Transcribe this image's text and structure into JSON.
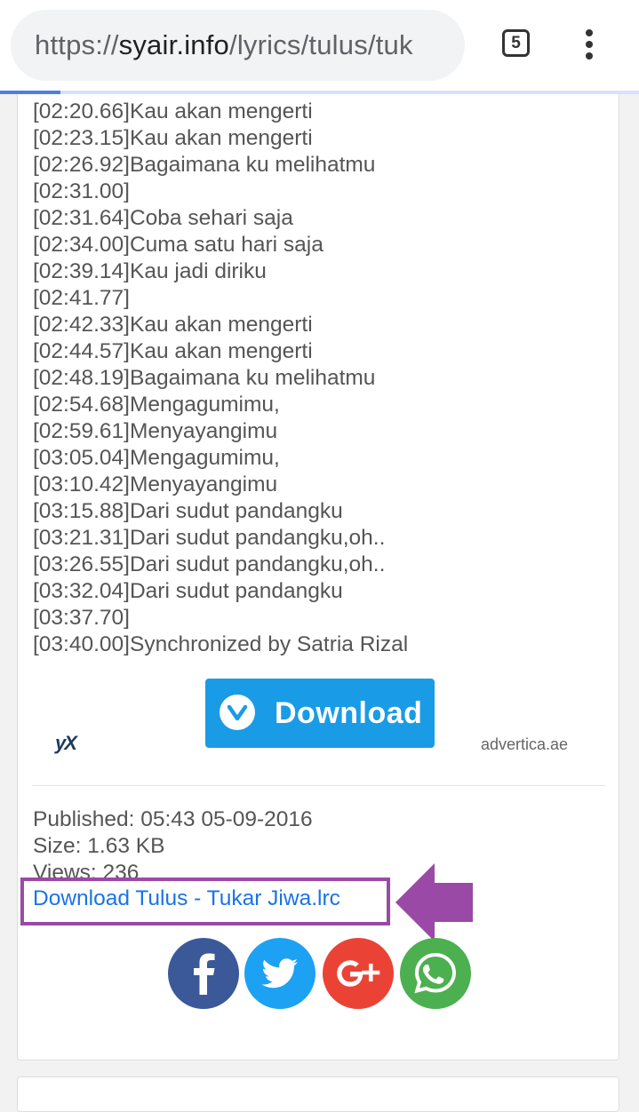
{
  "browser": {
    "url_prefix": "https://",
    "url_domain": "syair.info",
    "url_path": "/lyrics/tulus/tuk",
    "tab_count": "5"
  },
  "lyrics": [
    "[02:20.66]Kau akan mengerti",
    "[02:23.15]Kau akan mengerti",
    "[02:26.92]Bagaimana ku melihatmu",
    "[02:31.00]",
    "[02:31.64]Coba sehari saja",
    "[02:34.00]Cuma satu hari saja",
    "[02:39.14]Kau jadi diriku",
    "[02:41.77]",
    "[02:42.33]Kau akan mengerti",
    "[02:44.57]Kau akan mengerti",
    "[02:48.19]Bagaimana ku melihatmu",
    "[02:54.68]Mengagumimu,",
    "[02:59.61]Menyayangimu",
    "[03:05.04]Mengagumimu,",
    "[03:10.42]Menyayangimu",
    "[03:15.88]Dari sudut pandangku",
    "[03:21.31]Dari sudut pandangku,oh..",
    "[03:26.55]Dari sudut pandangku,oh..",
    "[03:32.04]Dari sudut pandangku",
    "[03:37.70]",
    "[03:40.00]Synchronized by Satria Rizal"
  ],
  "ad": {
    "button_label": "Download",
    "logo": "yX",
    "brand": "advertica.ae",
    "button_color": "#1a9be6"
  },
  "meta": {
    "published": "Published: 05:43 05-09-2016",
    "size": "Size: 1.63 KB",
    "views": "Views: 236"
  },
  "download_link": "Download Tulus - Tukar Jiwa.lrc",
  "annotation_color": "#9a4aa6",
  "share": [
    {
      "name": "facebook-icon",
      "color": "#3b5998"
    },
    {
      "name": "twitter-icon",
      "color": "#1da1f2"
    },
    {
      "name": "google-plus-icon",
      "color": "#ea4335"
    },
    {
      "name": "whatsapp-icon",
      "color": "#4caf50"
    }
  ]
}
